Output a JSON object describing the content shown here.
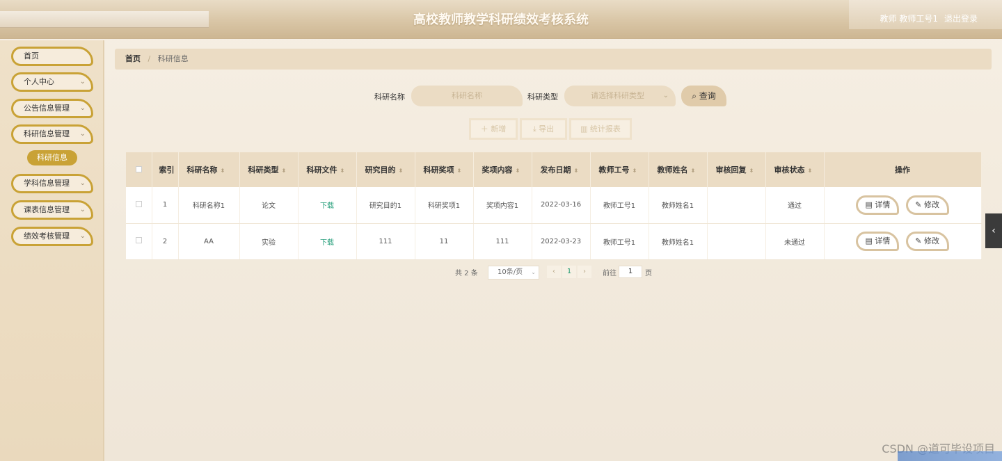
{
  "header": {
    "title": "高校教师教学科研绩效考核系统",
    "user": "教师 教师工号1",
    "logout": "退出登录"
  },
  "sidebar": {
    "items": [
      {
        "label": "首页"
      },
      {
        "label": "个人中心"
      },
      {
        "label": "公告信息管理"
      },
      {
        "label": "科研信息管理"
      },
      {
        "label": "学科信息管理"
      },
      {
        "label": "课表信息管理"
      },
      {
        "label": "绩效考核管理"
      }
    ],
    "active_sub": "科研信息"
  },
  "breadcrumb": {
    "home": "首页",
    "sep": "/",
    "current": "科研信息"
  },
  "search": {
    "name_label": "科研名称",
    "name_placeholder": "科研名称",
    "type_label": "科研类型",
    "type_placeholder": "请选择科研类型",
    "query_button": "查询"
  },
  "actions": {
    "add": "＋ 新增",
    "export": "⤓ 导出",
    "stats": "▥ 统计报表"
  },
  "table": {
    "headers": [
      "索引",
      "科研名称",
      "科研类型",
      "科研文件",
      "研究目的",
      "科研奖项",
      "奖项内容",
      "发布日期",
      "教师工号",
      "教师姓名",
      "审核回复",
      "审核状态",
      "操作"
    ],
    "rows": [
      {
        "index": "1",
        "name": "科研名称1",
        "type": "论文",
        "file": "下载",
        "purpose": "研究目的1",
        "award": "科研奖项1",
        "award_content": "奖项内容1",
        "date": "2022-03-16",
        "teacher_no": "教师工号1",
        "teacher_name": "教师姓名1",
        "reply": "",
        "status": "通过"
      },
      {
        "index": "2",
        "name": "AA",
        "type": "实验",
        "file": "下载",
        "purpose": "111",
        "award": "11",
        "award_content": "111",
        "date": "2022-03-23",
        "teacher_no": "教师工号1",
        "teacher_name": "教师姓名1",
        "reply": "",
        "status": "未通过"
      }
    ],
    "detail_button": "▤ 详情",
    "edit_button": "✎ 修改"
  },
  "pagination": {
    "total": "共 2 条",
    "page_size": "10条/页",
    "current_page": "1",
    "goto_label": "前往",
    "goto_value": "1",
    "goto_unit": "页"
  },
  "watermark": "CSDN @道可毕设项目",
  "colors": {
    "accent": "#c9a236",
    "header_bg": "#d9c6a6",
    "table_header_bg": "#ebdcc4",
    "download_link": "#2aa07d"
  }
}
